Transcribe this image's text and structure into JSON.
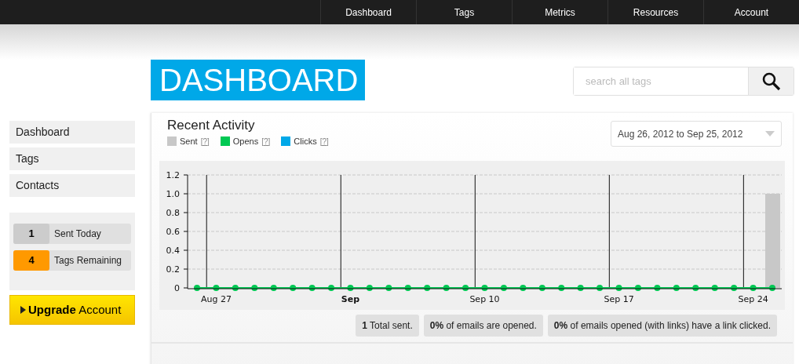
{
  "nav": [
    {
      "label": "Dashboard",
      "selected": false
    },
    {
      "label": "Tags",
      "selected": false
    },
    {
      "label": "Metrics",
      "selected": false
    },
    {
      "label": "Resources",
      "selected": false
    },
    {
      "label": "Account",
      "selected": false
    }
  ],
  "page_title": "DASHBOARD",
  "search": {
    "placeholder": "search all tags"
  },
  "sidebar": {
    "items": [
      {
        "label": "Dashboard"
      },
      {
        "label": "Tags"
      },
      {
        "label": "Contacts"
      }
    ],
    "stats": [
      {
        "value": "1",
        "label": "Sent Today",
        "color": "#cccccc"
      },
      {
        "value": "4",
        "label": "Tags Remaining",
        "color": "#ff9900"
      }
    ],
    "upgrade": {
      "bold": "Upgrade",
      "rest": "Account"
    }
  },
  "activity": {
    "title": "Recent Activity",
    "legend_help": [
      "[?]",
      "[?]",
      "[?]"
    ],
    "date_range": "Aug 26, 2012 to Sep 25, 2012",
    "chart_data": {
      "type": "bar",
      "categories": [
        null,
        "Aug 27",
        null,
        null,
        null,
        null,
        null,
        null,
        "Sep",
        null,
        null,
        null,
        null,
        null,
        null,
        "Sep 10",
        null,
        null,
        null,
        null,
        null,
        null,
        "Sep 17",
        null,
        null,
        null,
        null,
        null,
        null,
        "Sep 24",
        null
      ],
      "grid": true,
      "series": [
        {
          "name": "Sent",
          "color": "#c8c8c8",
          "values": [
            0,
            0,
            0,
            0,
            0,
            0,
            0,
            0,
            0,
            0,
            0,
            0,
            0,
            0,
            0,
            0,
            0,
            0,
            0,
            0,
            0,
            0,
            0,
            0,
            0,
            0,
            0,
            0,
            0,
            0,
            1
          ]
        },
        {
          "name": "Opens",
          "color": "#00c853",
          "values": [
            0,
            0,
            0,
            0,
            0,
            0,
            0,
            0,
            0,
            0,
            0,
            0,
            0,
            0,
            0,
            0,
            0,
            0,
            0,
            0,
            0,
            0,
            0,
            0,
            0,
            0,
            0,
            0,
            0,
            0,
            0
          ]
        },
        {
          "name": "Clicks",
          "color": "#00a8e8",
          "values": [
            null,
            null,
            null,
            null,
            null,
            null,
            null,
            null,
            null,
            null,
            null,
            null,
            null,
            null,
            null,
            null,
            null,
            null,
            null,
            null,
            null,
            null,
            null,
            null,
            null,
            null,
            null,
            null,
            null,
            null,
            null
          ]
        }
      ],
      "ylim": [
        0,
        1.2
      ],
      "yticks": [
        {
          "value": 0,
          "label": "0"
        },
        {
          "value": 0.2,
          "label": "0.2"
        },
        {
          "value": 0.4,
          "label": "0.4"
        },
        {
          "value": 0.6,
          "label": "0.6"
        },
        {
          "value": 0.8,
          "label": "0.8"
        },
        {
          "value": 1,
          "label": "1.0"
        },
        {
          "value": 1.2,
          "label": "1.2"
        }
      ]
    },
    "summary": [
      {
        "value": "1",
        "text": "Total sent."
      },
      {
        "value": "0%",
        "text": "of emails are opened."
      },
      {
        "value": "0%",
        "text": "of emails opened (with links) have a link clicked."
      }
    ]
  }
}
